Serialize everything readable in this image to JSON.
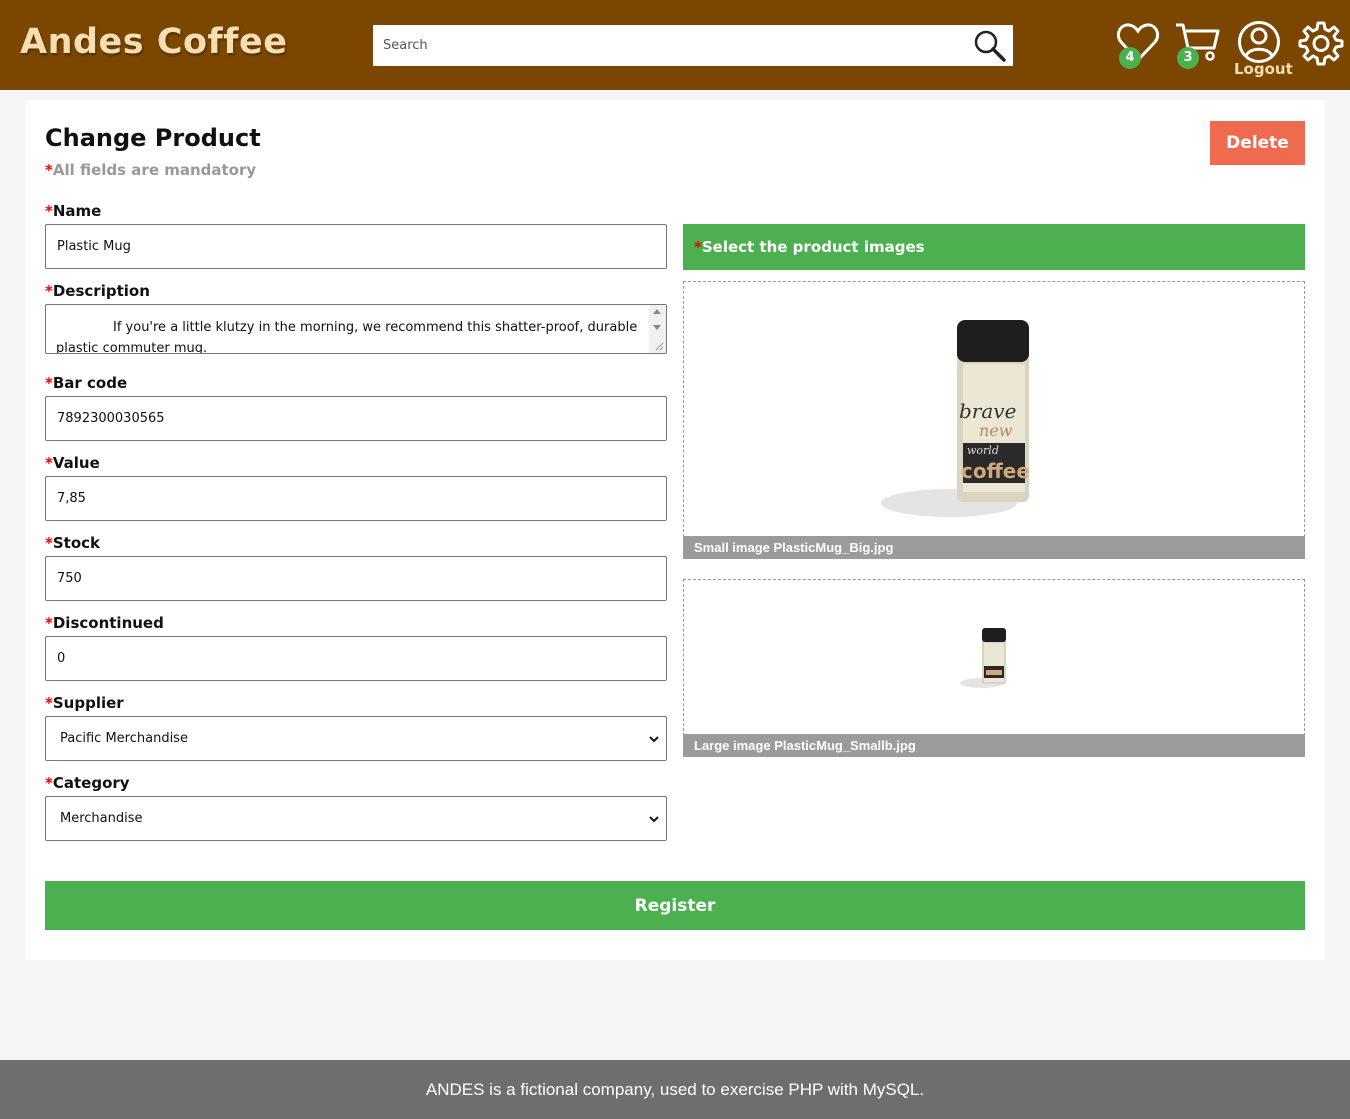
{
  "header": {
    "logo": "Andes Coffee",
    "search_placeholder": "Search",
    "wishlist_count": "4",
    "cart_count": "3",
    "logout_label": "Logout"
  },
  "form": {
    "title": "Change Product",
    "mandatory_star": "*",
    "mandatory_note": "All fields are mandatory",
    "delete_label": "Delete",
    "register_label": "Register",
    "fields": {
      "name": {
        "label": "Name",
        "value": "Plastic Mug"
      },
      "description": {
        "label": "Description",
        "value": "If you're a little klutzy in the morning, we recommend this shatter-proof, durable plastic commuter mug."
      },
      "barcode": {
        "label": "Bar code",
        "value": "7892300030565"
      },
      "value": {
        "label": "Value",
        "value": "7,85"
      },
      "stock": {
        "label": "Stock",
        "value": "750"
      },
      "discontinued": {
        "label": "Discontinued",
        "value": "0"
      },
      "supplier": {
        "label": "Supplier",
        "value": "Pacific Merchandise"
      },
      "category": {
        "label": "Category",
        "value": "Merchandise"
      }
    }
  },
  "images": {
    "header": "Select the product images",
    "small_caption": "Small image PlasticMug_Big.jpg",
    "large_caption": "Large image PlasticMug_Smallb.jpg",
    "mug_text_1": "brave",
    "mug_text_2": "new",
    "mug_text_3": "world",
    "mug_text_4": "coffee"
  },
  "footer": {
    "text": "ANDES is a fictional company, used to exercise PHP with MySQL."
  },
  "colors": {
    "header_bg": "#7b4600",
    "accent_green": "#4caf50",
    "delete_orange": "#ef6b4f",
    "footer_bg": "#6e6e6e"
  }
}
